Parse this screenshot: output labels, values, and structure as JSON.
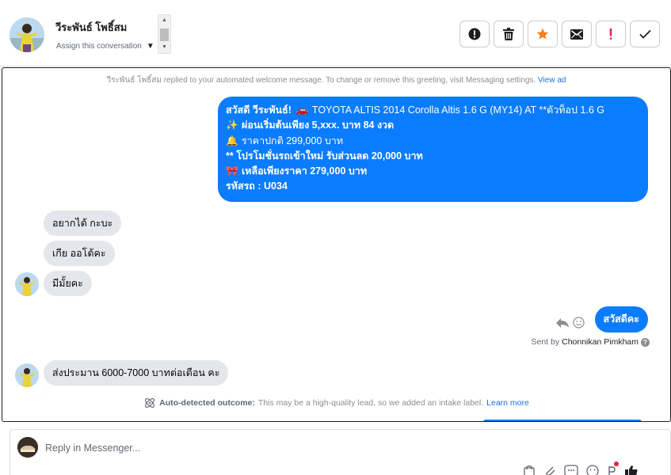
{
  "header": {
    "contact_name": "วีระพันธ์ โพธิ์สม",
    "assign_label": "Assign this conversation",
    "actions": [
      {
        "name": "mark-spam-button",
        "icon": "exclamation-circle-icon"
      },
      {
        "name": "delete-button",
        "icon": "trash-icon"
      },
      {
        "name": "star-button",
        "icon": "star-icon"
      },
      {
        "name": "mark-unread-button",
        "icon": "envelope-icon"
      },
      {
        "name": "follow-up-button",
        "icon": "red-exclamation-icon"
      },
      {
        "name": "mark-done-button",
        "icon": "checkmark-icon"
      }
    ]
  },
  "conversation": {
    "system_note": "วีระพันธ์ โพธิ์สม replied to your automated welcome message. To change or remove this greeting, visit Messaging settings.",
    "system_note_link": "View ad",
    "greeting": {
      "line1_prefix": "สวัสดี วีระพันธ์!",
      "line1_car_icon": "🚗",
      "line1_rest": "TOYOTA ALTIS 2014 Corolla Altis 1.6 G (MY14) AT **ตัวท็อป 1.6 G",
      "line2_icon": "✨",
      "line2_text": "ผ่อนเริ่มต้นเพียง 5,xxx. บาท 84 งวด",
      "line3_icon": "🔔",
      "line3_text": "ราคาปกติ 299,000 บาท",
      "line4_text": "** โปรโมชั่นรถเข้าใหม่ รับส่วนลด 20,000 บาท",
      "line5_icon": "🎀",
      "line5_text": "เหลือเพียงราคา 279,000 บาท",
      "line6_text": "รหัสรถ : U034"
    },
    "incoming_1": "อยากได้ กะบะ",
    "incoming_2": "เกีย ออโต้คะ",
    "incoming_3": "มีมั้ยคะ",
    "outgoing_reply": "สวัสดีคะ",
    "sent_by_label": "Sent by",
    "sent_by_name": "Chonnikan Pimkham",
    "incoming_4": "ส่งประมาน 6000-7000 บาทต่อเดือน คะ",
    "outcome_label": "Auto-detected outcome:",
    "outcome_text": "This may be a high-quality lead, so we added an intake label.",
    "outcome_link": "Learn more"
  },
  "composer": {
    "placeholder": "Reply in Messenger...",
    "tool_icons": [
      "shopping-bag-icon",
      "paperclip-icon",
      "saved-reply-icon",
      "emoji-icon",
      "payment-icon",
      "thumbs-up-icon"
    ]
  },
  "colors": {
    "accent_blue": "#0a7cff",
    "incoming_bubble": "#e4e6eb",
    "star_orange": "#f5821f",
    "alert_red": "#e41e3f"
  }
}
